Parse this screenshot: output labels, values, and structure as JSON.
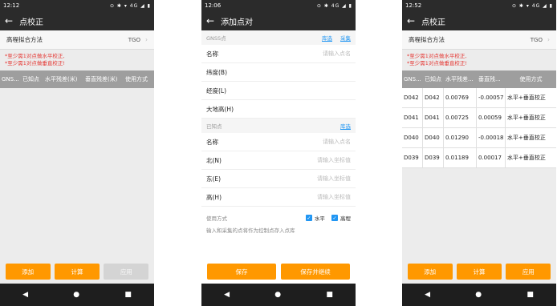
{
  "phone1": {
    "status_time": "12:12",
    "status_icons": "⊙ ✱ ▾ 4G ◢ ▮",
    "title": "点校正",
    "method_label": "高程拟合方法",
    "method_value": "TGO",
    "warnings": [
      "*至少需1对点做水平校正,",
      "*至少需1对点做垂直校正!"
    ],
    "columns": [
      "GNS...",
      "已知点",
      "水平残差(米)",
      "垂直残差(米)",
      "使用方式"
    ],
    "buttons": {
      "add": "添加",
      "calc": "计算",
      "apply": "应用"
    }
  },
  "phone2": {
    "status_time": "12:06",
    "status_icons": "⊙ ✱ 4G ◢ ▮",
    "title": "添加点对",
    "gnss_section": "GNSS点",
    "gnss_link1": "库选",
    "gnss_link2": "采集",
    "gnss_fields": [
      {
        "label": "名称",
        "placeholder": "请输入点名"
      },
      {
        "label": "纬度(B)",
        "placeholder": ""
      },
      {
        "label": "经度(L)",
        "placeholder": ""
      },
      {
        "label": "大地高(H)",
        "placeholder": ""
      }
    ],
    "known_section": "已知点",
    "known_link": "库选",
    "known_fields": [
      {
        "label": "名称",
        "placeholder": "请输入点名"
      },
      {
        "label": "北(N)",
        "placeholder": "请输入坐标值"
      },
      {
        "label": "东(E)",
        "placeholder": "请输入坐标值"
      },
      {
        "label": "高(H)",
        "placeholder": "请输入坐标值"
      }
    ],
    "use_label": "使用方式",
    "check_horizontal": "水平",
    "check_vertical": "高程",
    "note": "输入和采集的点将作为控制点存入点库",
    "buttons": {
      "save": "保存",
      "save_continue": "保存并继续"
    }
  },
  "phone3": {
    "status_time": "12:52",
    "status_icons": "⊙ ✱ ▾ 4G ◢ ▮",
    "title": "点校正",
    "method_label": "高程拟合方法",
    "method_value": "TGO",
    "warnings": [
      "*至少需1对点做水平校正,",
      "*至少需1对点做垂直校正!"
    ],
    "columns": [
      "GNS...",
      "已知点",
      "水平残差...",
      "垂直残...",
      "使用方式"
    ],
    "rows": [
      [
        "D042",
        "D042",
        "0.00769",
        "-0.00057",
        "水平+垂直校正"
      ],
      [
        "D041",
        "D041",
        "0.00725",
        "0.00059",
        "水平+垂直校正"
      ],
      [
        "D040",
        "D040",
        "0.01290",
        "-0.00018",
        "水平+垂直校正"
      ],
      [
        "D039",
        "D039",
        "0.01189",
        "0.00017",
        "水平+垂直校正"
      ]
    ],
    "buttons": {
      "add": "添加",
      "calc": "计算",
      "apply": "应用"
    }
  },
  "nav": {
    "back": "◀",
    "home": "●",
    "recent": "■"
  }
}
